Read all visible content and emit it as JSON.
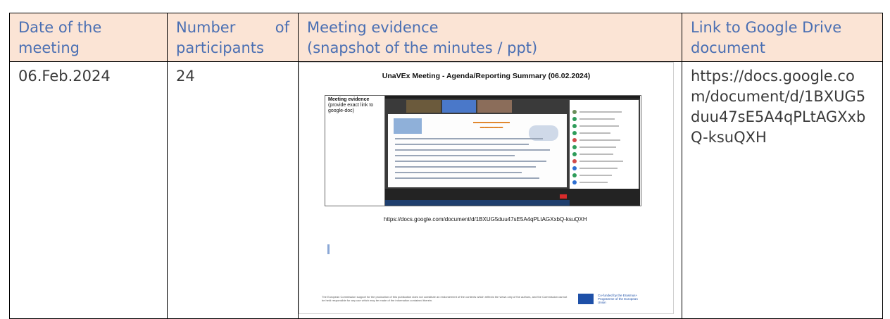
{
  "table": {
    "headers": {
      "date": "Date of the meeting",
      "participants_word1": "Number",
      "participants_word2": "of",
      "participants_word3": "participants",
      "evidence_line1": "Meeting evidence",
      "evidence_line2": "(snapshot of the minutes / ppt)",
      "link": "Link to Google Drive document"
    },
    "row": {
      "date": "06.Feb.2024",
      "participants": "24",
      "link": "https://docs.google.com/document/d/1BXUG5duu47sE5A4qPLtAGXxbQ-ksuQXH"
    }
  },
  "snapshot": {
    "title": "UnaVEx Meeting - Agenda/Reporting Summary (06.02.2024)",
    "label_bold": "Meeting evidence",
    "label_rest": "(provide exact link to google-doc)",
    "link": "https://docs.google.com/document/d/1BXUG5duu47sE5A4qPLtAGXxbQ-ksuQXH",
    "disclaimer": "The European Commission support for the production of this publication does not constitute an endorsement of the contents which reflects the views only of the authors, and the Commission cannot be held responsible for any use which may be made of the information contained therein.",
    "eu_text": "Co-funded by the Erasmus+ Programme of the European Union",
    "accent_orange": "#e0852a",
    "eu_blue": "#1e50a8"
  },
  "colors": {
    "header_bg": "#fbe4d5",
    "header_text": "#4a6fb3",
    "body_text": "#3a3a3a"
  }
}
